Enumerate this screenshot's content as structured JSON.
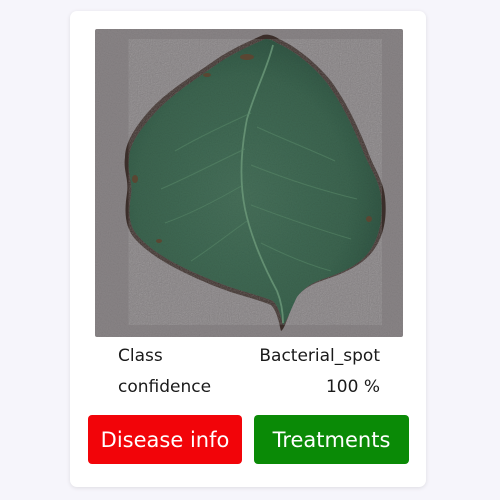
{
  "result": {
    "class_label": "Class",
    "class_value": "Bacterial_spot",
    "confidence_label": "confidence",
    "confidence_value": "100 %"
  },
  "actions": {
    "disease_info_label": "Disease info",
    "treatments_label": "Treatments"
  },
  "colors": {
    "disease_button": "#f20409",
    "treatments_button": "#0a8a06",
    "page_background": "#f6f5fb",
    "card_background": "#ffffff"
  },
  "image": {
    "subject": "green leaf on gray surface"
  }
}
